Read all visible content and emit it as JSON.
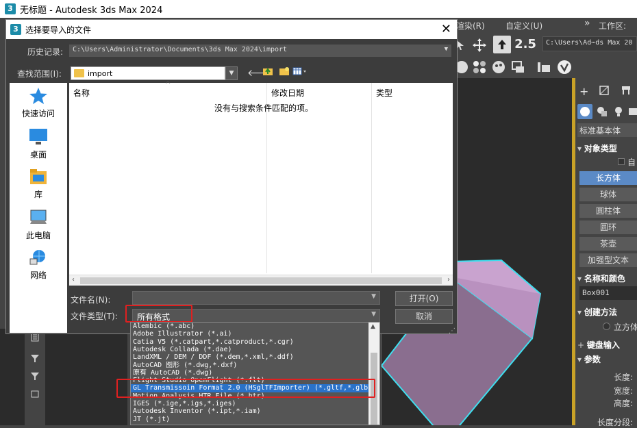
{
  "app": {
    "title": "无标题 - Autodesk 3ds Max 2024",
    "logo": "3"
  },
  "menu": {
    "render": "渲染(R)",
    "customize": "自定义(U)",
    "more": "»",
    "workspace": "工作区:"
  },
  "toolbar": {
    "path": "C:\\Users\\Ad⋯ds Max 20",
    "snap_label": "2.5"
  },
  "dialog": {
    "title": "选择要导入的文件",
    "logo": "3",
    "close": "✕",
    "history_label": "历史记录:",
    "history_value": "C:\\Users\\Administrator\\Documents\\3ds Max 2024\\import",
    "lookin_label": "查找范围(I):",
    "lookin_value": "import",
    "places": [
      {
        "label": "快速访问",
        "icon": "star-icon"
      },
      {
        "label": "桌面",
        "icon": "desktop-icon"
      },
      {
        "label": "库",
        "icon": "library-icon"
      },
      {
        "label": "此电脑",
        "icon": "computer-icon"
      },
      {
        "label": "网络",
        "icon": "network-icon"
      }
    ],
    "columns": [
      "名称",
      "修改日期",
      "类型"
    ],
    "empty_message": "没有与搜索条件匹配的项。",
    "filename_label": "文件名(N):",
    "filename_value": "",
    "filetype_label": "文件类型(T):",
    "filetype_value": "所有格式",
    "open_button": "打开(O)",
    "cancel_button": "取消"
  },
  "filetypes": [
    "Alembic (*.abc)",
    "Adobe Illustrator (*.ai)",
    "Catia V5 (*.catpart,*.catproduct,*.cgr)",
    "Autodesk Collada (*.dae)",
    "LandXML / DEM / DDF (*.dem,*.xml,*.ddf)",
    "AutoCAD 图形 (*.dwg,*.dxf)",
    "原有 AutoCAD (*.dwg)",
    "Flight Studio OpenFlight (*.flt)",
    "GL Transmissoin Format 2.0 (HSglTFImporter) (*.gltf,*.glb)",
    "Motion Analysis HTR File (*.htr)",
    "IGES (*.ige,*.igs,*.iges)",
    "Autodesk Inventor (*.ipt,*.iam)",
    "JT (*.jt)"
  ],
  "selected_filetype_index": 8,
  "command_panel": {
    "category": "标准基本体",
    "object_type_header": "对象类型",
    "autogrid": "自",
    "buttons": [
      "长方体",
      "球体",
      "圆柱体",
      "圆环",
      "茶壶",
      "加强型文本"
    ],
    "active_button": 0,
    "name_color_header": "名称和颜色",
    "object_name": "Box001",
    "creation_header": "创建方法",
    "creation_option": "立方体",
    "keyboard_header": "键盘输入",
    "params_header": "参数",
    "length": "长度:",
    "width": "宽度:",
    "height": "高度:",
    "length_segs": "长度分段:"
  },
  "colors": {
    "accent_blue": "#2a72c9",
    "highlight_red": "#e02020",
    "box_fill": "#c9a3cf",
    "box_edge": "#3fe0f0"
  }
}
